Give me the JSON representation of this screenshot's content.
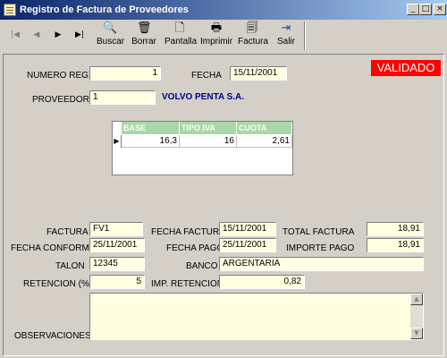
{
  "window": {
    "title": "Registro de Factura de Proveedores",
    "minimize": "_",
    "maximize": "□",
    "close": "×"
  },
  "toolbar": {
    "nav": [
      {
        "name": "first-record-button",
        "glyph": "|◀"
      },
      {
        "name": "prev-record-button",
        "glyph": "◀"
      },
      {
        "name": "next-record-button",
        "glyph": "▶"
      },
      {
        "name": "last-record-button",
        "glyph": "▶|"
      }
    ],
    "buttons": [
      {
        "name": "buscar",
        "label": "Buscar",
        "icon": "search-icon",
        "glyph": "🔍"
      },
      {
        "name": "borrar",
        "label": "Borrar",
        "icon": "trash-icon",
        "glyph": "🗑"
      },
      {
        "name": "pantalla",
        "label": "Pantalla",
        "icon": "print-preview-icon",
        "glyph": "🗋"
      },
      {
        "name": "imprimir",
        "label": "Imprimir",
        "icon": "printer-icon",
        "glyph": "🖶"
      },
      {
        "name": "factura",
        "label": "Factura",
        "icon": "invoice-search-icon",
        "glyph": "🗐"
      },
      {
        "name": "salir",
        "label": "Salir",
        "icon": "exit-icon",
        "glyph": "⇥"
      }
    ]
  },
  "status_badge": {
    "text": "VALIDADO",
    "color": "#ff0000"
  },
  "form": {
    "numero_reg": {
      "label": "NUMERO REG.",
      "value": "1"
    },
    "fecha": {
      "label": "FECHA",
      "value": "15/11/2001"
    },
    "proveedor": {
      "label": "PROVEEDOR",
      "value": "1",
      "name": "VOLVO PENTA S.A."
    },
    "factura": {
      "label": "FACTURA",
      "value": "FV1"
    },
    "fecha_factura": {
      "label": "FECHA FACTURA",
      "value": "15/11/2001"
    },
    "total_factura": {
      "label": "TOTAL FACTURA",
      "value": "18,91"
    },
    "fecha_conforme": {
      "label": "FECHA CONFORME",
      "value": "25/11/2001"
    },
    "fecha_pago": {
      "label": "FECHA PAGO",
      "value": "25/11/2001"
    },
    "importe_pago": {
      "label": "IMPORTE PAGO",
      "value": "18,91"
    },
    "talon": {
      "label": "TALON",
      "value": "12345"
    },
    "banco": {
      "label": "BANCO",
      "value": "ARGENTARIA"
    },
    "retencion": {
      "label": "RETENCION (%)",
      "value": "5"
    },
    "imp_retencion": {
      "label": "IMP. RETENCION",
      "value": "0,82"
    },
    "observaciones": {
      "label": "OBSERVACIONES",
      "value": ""
    }
  },
  "grid": {
    "columns": [
      "BASE",
      "TIPO IVA",
      "CUOTA"
    ],
    "rows": [
      [
        "16,3",
        "16",
        "2,61"
      ]
    ],
    "header_color": "#a8d8a8"
  }
}
